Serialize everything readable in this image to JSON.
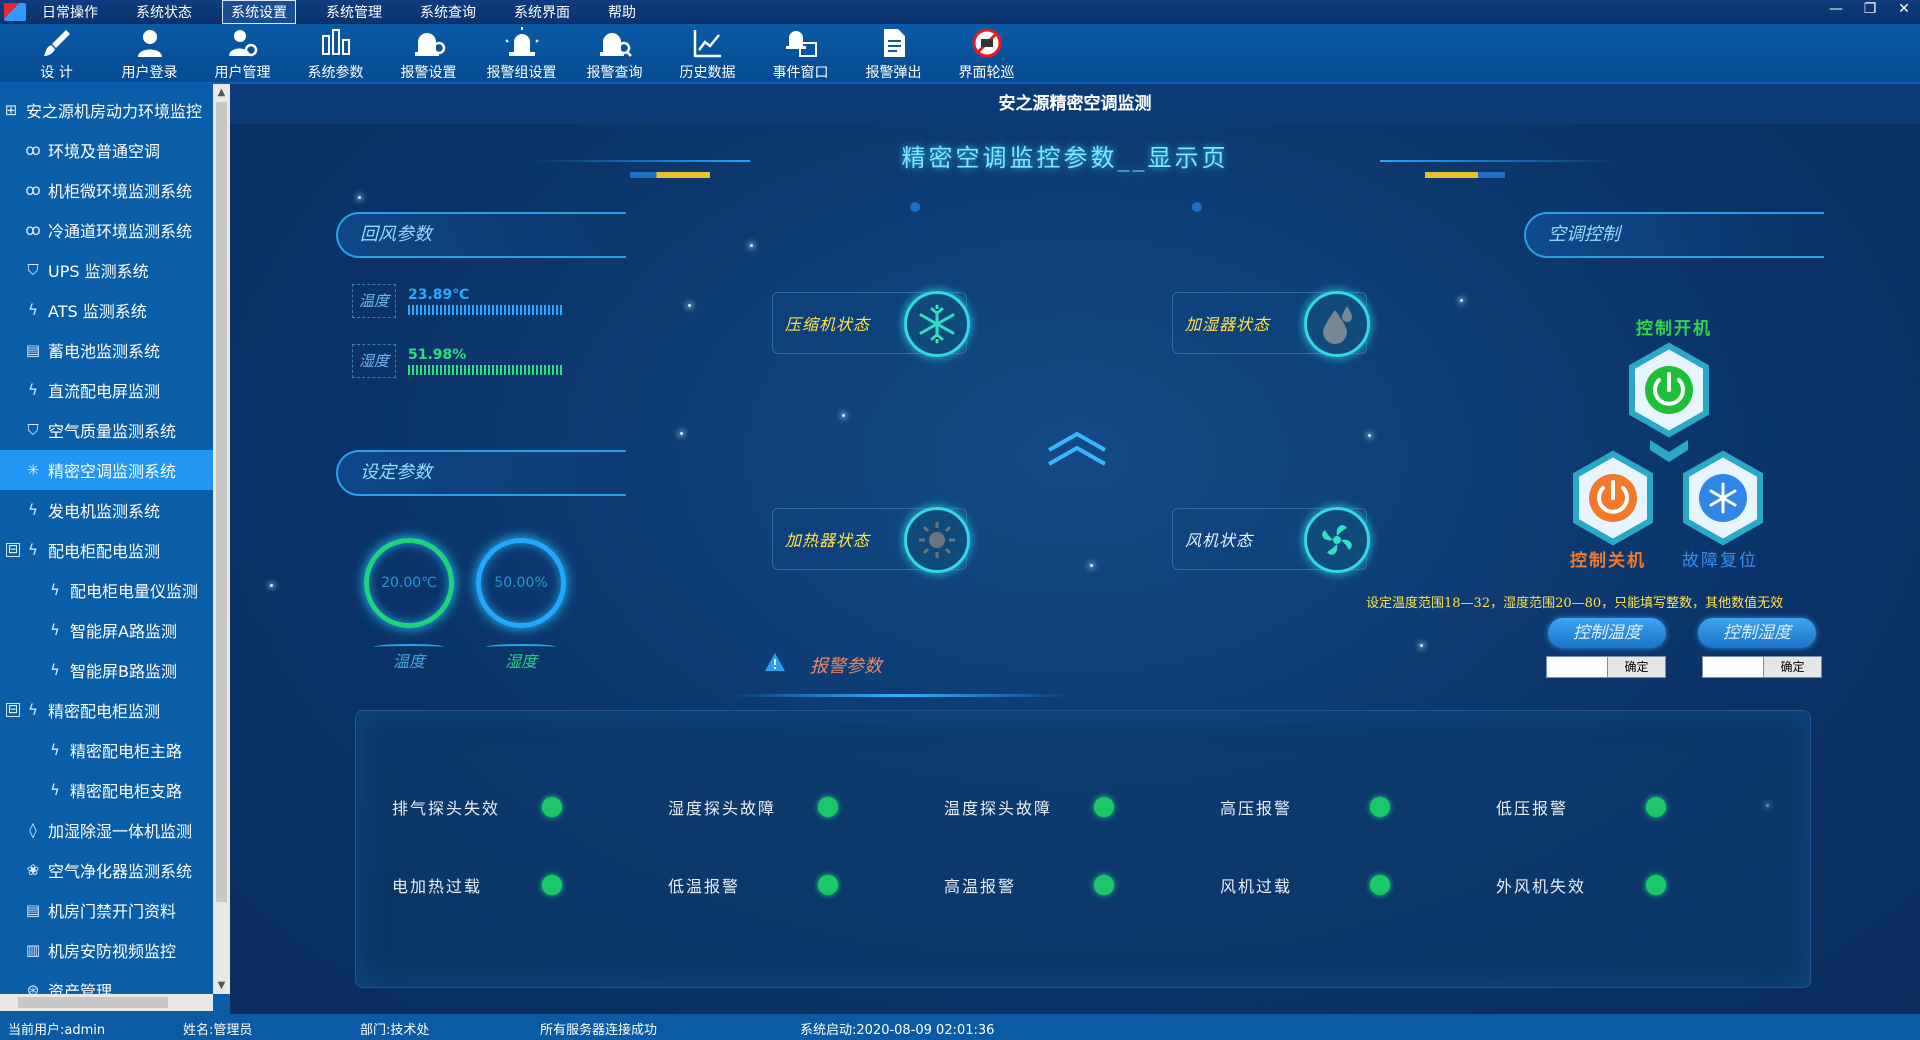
{
  "menu": [
    "日常操作",
    "系统状态",
    "系统设置",
    "系统管理",
    "系统查询",
    "系统界面",
    "帮助"
  ],
  "menu_active": "系统设置",
  "window_controls": [
    "—",
    "❐",
    "✕"
  ],
  "toolbar": [
    {
      "label": "设 计",
      "icon": "brush-icon"
    },
    {
      "label": "用户登录",
      "icon": "user-icon"
    },
    {
      "label": "用户管理",
      "icon": "user-gear-icon"
    },
    {
      "label": "系统参数",
      "icon": "bars-icon"
    },
    {
      "label": "报警设置",
      "icon": "alarm-gear-icon"
    },
    {
      "label": "报警组设置",
      "icon": "alarm-group-icon"
    },
    {
      "label": "报警查询",
      "icon": "alarm-search-icon"
    },
    {
      "label": "历史数据",
      "icon": "chart-icon"
    },
    {
      "label": "事件窗口",
      "icon": "event-window-icon"
    },
    {
      "label": "报警弹出",
      "icon": "document-icon"
    },
    {
      "label": "界面轮巡",
      "icon": "patrol-icon"
    }
  ],
  "sidebar": {
    "root": "安之源机房动力环境监控",
    "items": [
      {
        "label": "环境及普通空调",
        "icon": "ꝏ",
        "indent": 1
      },
      {
        "label": "机柜微环境监测系统",
        "icon": "ꝏ",
        "indent": 1
      },
      {
        "label": "冷通道环境监测系统",
        "icon": "ꝏ",
        "indent": 1
      },
      {
        "label": "UPS 监测系统",
        "icon": "⛉",
        "indent": 1
      },
      {
        "label": "ATS 监测系统",
        "icon": "ϟ",
        "indent": 1
      },
      {
        "label": "蓄电池监测系统",
        "icon": "▤",
        "indent": 1
      },
      {
        "label": "直流配电屏监测",
        "icon": "ϟ",
        "indent": 1
      },
      {
        "label": "空气质量监测系统",
        "icon": "⛉",
        "indent": 1
      },
      {
        "label": "精密空调监测系统",
        "icon": "✳",
        "indent": 1,
        "selected": true
      },
      {
        "label": "发电机监测系统",
        "icon": "ϟ",
        "indent": 1
      },
      {
        "label": "配电柜配电监测",
        "icon": "ϟ",
        "indent": 0,
        "expander": "⊟"
      },
      {
        "label": "配电柜电量仪监测",
        "icon": "ϟ",
        "indent": 2
      },
      {
        "label": "智能屏A路监测",
        "icon": "ϟ",
        "indent": 2
      },
      {
        "label": "智能屏B路监测",
        "icon": "ϟ",
        "indent": 2
      },
      {
        "label": "精密配电柜监测",
        "icon": "ϟ",
        "indent": 0,
        "expander": "⊟"
      },
      {
        "label": "精密配电柜主路",
        "icon": "ϟ",
        "indent": 2
      },
      {
        "label": "精密配电柜支路",
        "icon": "ϟ",
        "indent": 2
      },
      {
        "label": "加湿除湿一体机监测",
        "icon": "◊",
        "indent": 1
      },
      {
        "label": "空气净化器监测系统",
        "icon": "❀",
        "indent": 1
      },
      {
        "label": "机房门禁开门资料",
        "icon": "▤",
        "indent": 1
      },
      {
        "label": "机房安防视频监控",
        "icon": "▥",
        "indent": 1
      },
      {
        "label": "资产管理",
        "icon": "⊛",
        "indent": 1
      }
    ]
  },
  "main": {
    "window_title": "安之源精密空调监测",
    "headline": "精密空调监控参数__显示页",
    "return_air": {
      "title": "回风参数",
      "temp_label": "温度",
      "temp_value": "23.89℃",
      "temp_color": "#2ea9ff",
      "hum_label": "湿度",
      "hum_value": "51.98%",
      "hum_color": "#29e07a"
    },
    "set_params": {
      "title": "设定参数",
      "temp_value": "20.00℃",
      "temp_caption": "温度",
      "hum_value": "50.00%",
      "hum_caption": "湿度"
    },
    "status": {
      "compressor": "压缩机状态",
      "humidifier": "加湿器状态",
      "heater": "加热器状态",
      "fan": "风机状态"
    },
    "control": {
      "title": "空调控制",
      "power_on": "控制开机",
      "power_off": "控制关机",
      "fault_reset": "故障复位",
      "note": "设定温度范围18—32，湿度范围20—80，只能填写整数，其他数值无效",
      "set_temp_label": "控制温度",
      "set_hum_label": "控制湿度",
      "confirm": "确定",
      "on_color": "#1fbf3a",
      "off_color": "#f07a2a",
      "reset_color": "#2f86e8"
    },
    "alarm": {
      "title": "报警参数",
      "items": [
        "排气探头失效",
        "湿度探头故障",
        "温度探头故障",
        "高压报警",
        "低压报警",
        "电加热过载",
        "低温报警",
        "高温报警",
        "风机过载",
        "外风机失效"
      ]
    }
  },
  "statusbar": {
    "user": "当前用户:admin",
    "name": "姓名:管理员",
    "dept": "部门:技术处",
    "server": "所有服务器连接成功",
    "start": "系统启动:2020-08-09 02:01:36"
  }
}
